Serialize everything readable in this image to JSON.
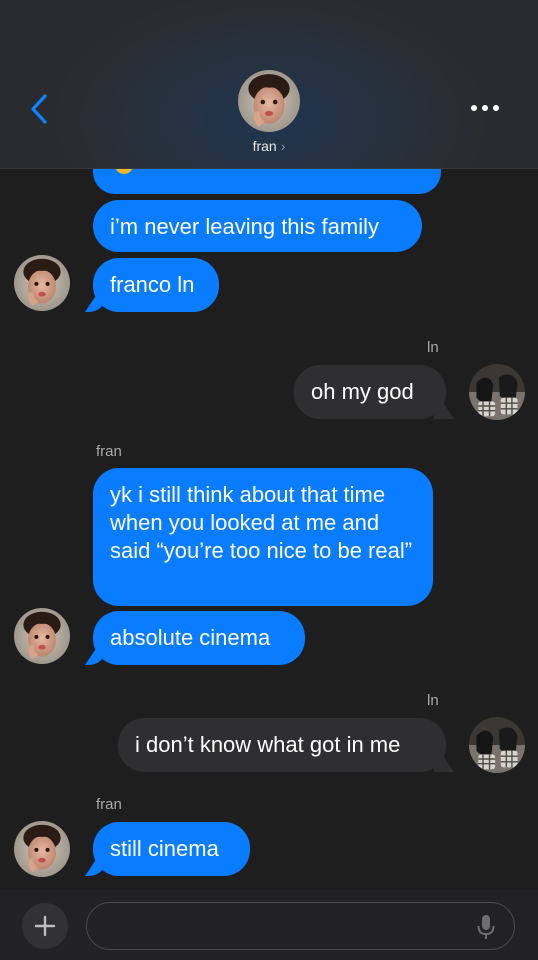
{
  "header": {
    "contact_name": "fran",
    "chevron": "›",
    "back_icon": "chevron-left-icon",
    "more_icon": "ellipsis-icon"
  },
  "messages": [
    {
      "side": "left",
      "text": "",
      "note": "partial emoji bubble cut off"
    },
    {
      "side": "left",
      "text": "i’m never leaving this family"
    },
    {
      "side": "left",
      "text": "franco ln"
    },
    {
      "side": "right",
      "sender": "ln",
      "text": "oh my god"
    },
    {
      "side": "left",
      "sender": "fran",
      "text": "yk i still think about that time when you looked at me and said “you’re too nice to be real”"
    },
    {
      "side": "left",
      "text": "absolute cinema"
    },
    {
      "side": "right",
      "sender": "ln",
      "text": "i don’t know what got in me"
    },
    {
      "side": "left",
      "sender": "fran",
      "text": "still cinema"
    }
  ],
  "composer": {
    "placeholder": "",
    "add_icon": "plus-icon",
    "mic_icon": "microphone-icon"
  },
  "colors": {
    "background": "#1e1e1e",
    "outgoing_bubble": "#0a7cff",
    "incoming_bubble": "#2f2f31",
    "accent": "#0a7cff"
  }
}
